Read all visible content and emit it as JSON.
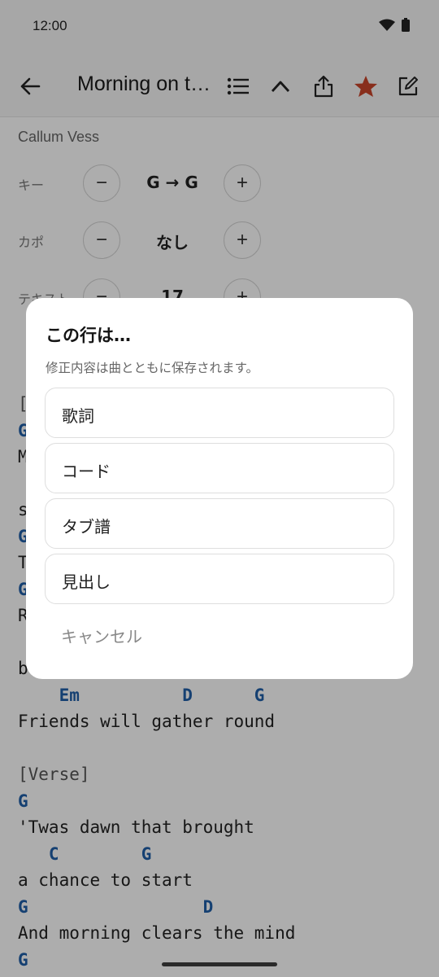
{
  "status": {
    "time": "12:00"
  },
  "app_bar": {
    "title": "Morning on the Hill"
  },
  "song": {
    "artist": "Callum Vess",
    "controls": [
      {
        "label": "キー",
        "value": "G → G"
      },
      {
        "label": "カポ",
        "value": "なし"
      },
      {
        "label": "テキスト",
        "value": "17"
      }
    ]
  },
  "sheet_lines": [
    {
      "text": "[",
      "kind": "section"
    },
    {
      "text": "G",
      "kind": "chord"
    },
    {
      "text": "M",
      "kind": "lyric"
    },
    {
      "text": "",
      "kind": "lyric"
    },
    {
      "text": "s",
      "kind": "lyric"
    },
    {
      "text": "G",
      "kind": "chord"
    },
    {
      "text": "T",
      "kind": "lyric"
    },
    {
      "text": "G",
      "kind": "chord"
    },
    {
      "text": "R",
      "kind": "lyric"
    },
    {
      "text": "",
      "kind": "lyric"
    },
    {
      "text": "b",
      "kind": "lyric"
    },
    {
      "text": "    Em          D      G",
      "kind": "chord"
    },
    {
      "text": "Friends will gather round",
      "kind": "lyric"
    },
    {
      "text": "",
      "kind": "lyric"
    },
    {
      "text": "[Verse]",
      "kind": "section"
    },
    {
      "text": "G",
      "kind": "chord"
    },
    {
      "text": "'Twas dawn that brought",
      "kind": "lyric"
    },
    {
      "text": "   C        G",
      "kind": "chord"
    },
    {
      "text": "a chance to start",
      "kind": "lyric"
    },
    {
      "text": "G                 D",
      "kind": "chord"
    },
    {
      "text": "And morning clears the mind",
      "kind": "lyric"
    },
    {
      "text": "G",
      "kind": "chord"
    }
  ],
  "dialog": {
    "title": "この行は…",
    "subtitle": "修正内容は曲とともに保存されます。",
    "options": [
      "歌詞",
      "コード",
      "タブ譜",
      "見出し"
    ],
    "cancel": "キャンセル"
  },
  "colors": {
    "chord": "#1f5fa8",
    "favorite": "#c9452a"
  },
  "icons": [
    "wifi-icon",
    "battery-icon",
    "back-arrow-icon",
    "list-icon",
    "chevron-up-icon",
    "share-icon",
    "star-icon",
    "edit-icon",
    "minus-icon",
    "plus-icon"
  ]
}
